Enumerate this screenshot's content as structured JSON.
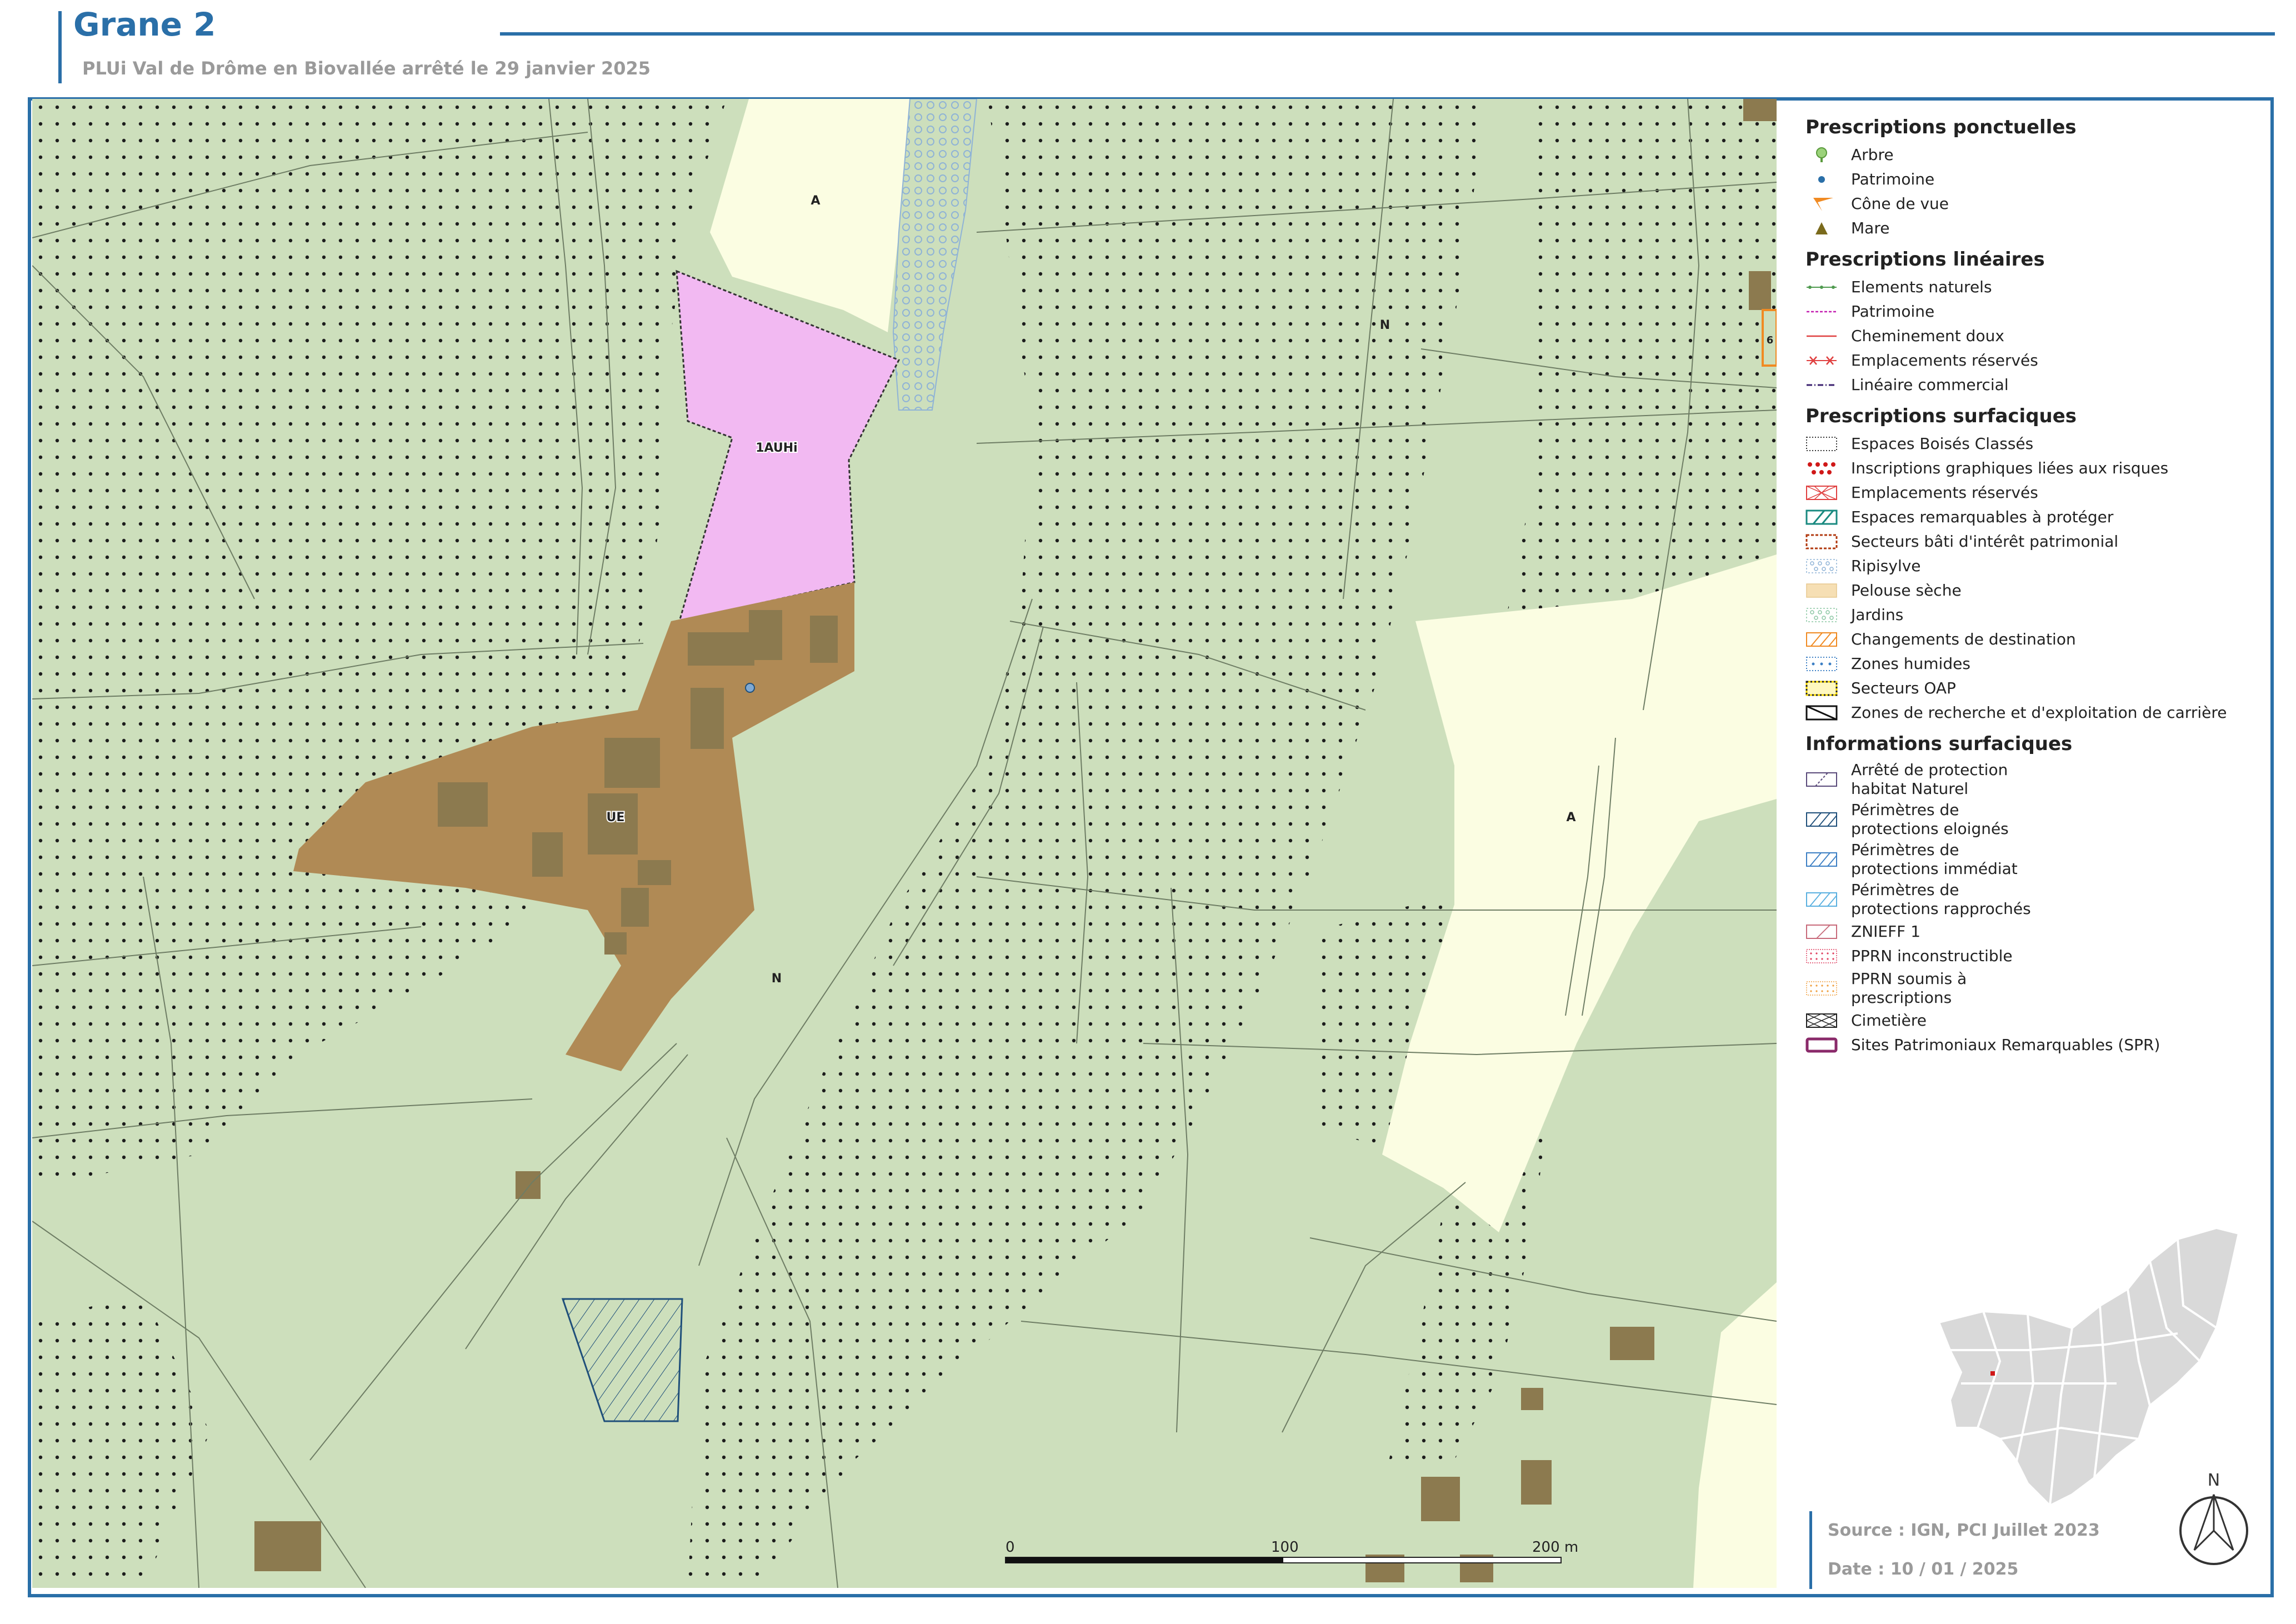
{
  "header": {
    "title": "Grane 2",
    "subtitle": "PLUi Val de Drôme en Biovallée arrêté le 29 janvier 2025"
  },
  "map": {
    "zone_labels": {
      "a_top": "A",
      "n_top_right": "N",
      "auhi": "1AUHi",
      "ue": "UE",
      "n_center": "N",
      "a_right": "A"
    },
    "side_label": "6",
    "scale": {
      "tick_0": "0",
      "tick_100": "100",
      "tick_200": "200 m"
    },
    "colors": {
      "zone_n": "#cddfbc",
      "zone_a": "#fbfde2",
      "zone_1auhi": "#f2b9f2",
      "zone_ue": "#b08a55",
      "building": "#8c7a4f",
      "ebc_dots": "#1d1d1d"
    }
  },
  "legend": {
    "sections": [
      {
        "title": "Prescriptions ponctuelles",
        "items": [
          {
            "label": "Arbre",
            "icon": "tree-icon"
          },
          {
            "label": "Patrimoine",
            "icon": "dot-icon"
          },
          {
            "label": "Cône de vue",
            "icon": "view-cone-icon"
          },
          {
            "label": "Mare",
            "icon": "triangle-icon"
          }
        ]
      },
      {
        "title": "Prescriptions linéaires",
        "items": [
          {
            "label": "Elements naturels",
            "icon": "line-green-dots"
          },
          {
            "label": "Patrimoine",
            "icon": "line-magenta-dash"
          },
          {
            "label": "Cheminement doux",
            "icon": "line-red"
          },
          {
            "label": "Emplacements réservés",
            "icon": "line-red-cross"
          },
          {
            "label": "Linéaire commercial",
            "icon": "line-purple-dash"
          }
        ]
      },
      {
        "title": "Prescriptions surfaciques",
        "items": [
          {
            "label": "Espaces Boisés Classés",
            "icon": "box-dots"
          },
          {
            "label": "Inscriptions graphiques liées aux risques",
            "icon": "box-red-dots"
          },
          {
            "label": "Emplacements réservés",
            "icon": "box-red-cross"
          },
          {
            "label": "Espaces remarquables à protéger",
            "icon": "box-teal-hatch"
          },
          {
            "label": "Secteurs bâti d'intérêt patrimonial",
            "icon": "box-brown-dash"
          },
          {
            "label": "Ripisylve",
            "icon": "box-blue-circles"
          },
          {
            "label": "Pelouse sèche",
            "icon": "box-tan"
          },
          {
            "label": "Jardins",
            "icon": "box-green-circles"
          },
          {
            "label": "Changements de destination",
            "icon": "box-orange-hatch"
          },
          {
            "label": "Zones humides",
            "icon": "box-blue-dots"
          },
          {
            "label": "Secteurs OAP",
            "icon": "box-yellow-dash"
          },
          {
            "label": "Zones de recherche et d'exploitation de carrière",
            "icon": "box-black-diag"
          }
        ]
      },
      {
        "title": "Informations surfaciques",
        "items": [
          {
            "label": "Arrêté de protection\nhabitat Naturel",
            "icon": "box-purple-diag",
            "tall": true
          },
          {
            "label": "Périmètres de\nprotections eloignés",
            "icon": "box-navy-hatch",
            "tall": true
          },
          {
            "label": "Périmètres de\nprotections immédiat",
            "icon": "box-blue-hatch",
            "tall": true
          },
          {
            "label": "Périmètres de\nprotections rapprochés",
            "icon": "box-lightblue-hatch",
            "tall": true
          },
          {
            "label": "ZNIEFF 1",
            "icon": "box-pink-hatch"
          },
          {
            "label": "PPRN inconstructible",
            "icon": "box-red-dotgrid"
          },
          {
            "label": "PPRN soumis à\nprescriptions",
            "icon": "box-orange-dotgrid",
            "tall": true
          },
          {
            "label": "Cimetière",
            "icon": "box-cross-hatch"
          },
          {
            "label": "Sites Patrimoniaux Remarquables (SPR)",
            "icon": "box-spr"
          }
        ]
      }
    ]
  },
  "footer": {
    "source": "Source : IGN, PCI Juillet 2023",
    "date": "Date : 10 / 01 / 2025",
    "north_label": "N"
  }
}
